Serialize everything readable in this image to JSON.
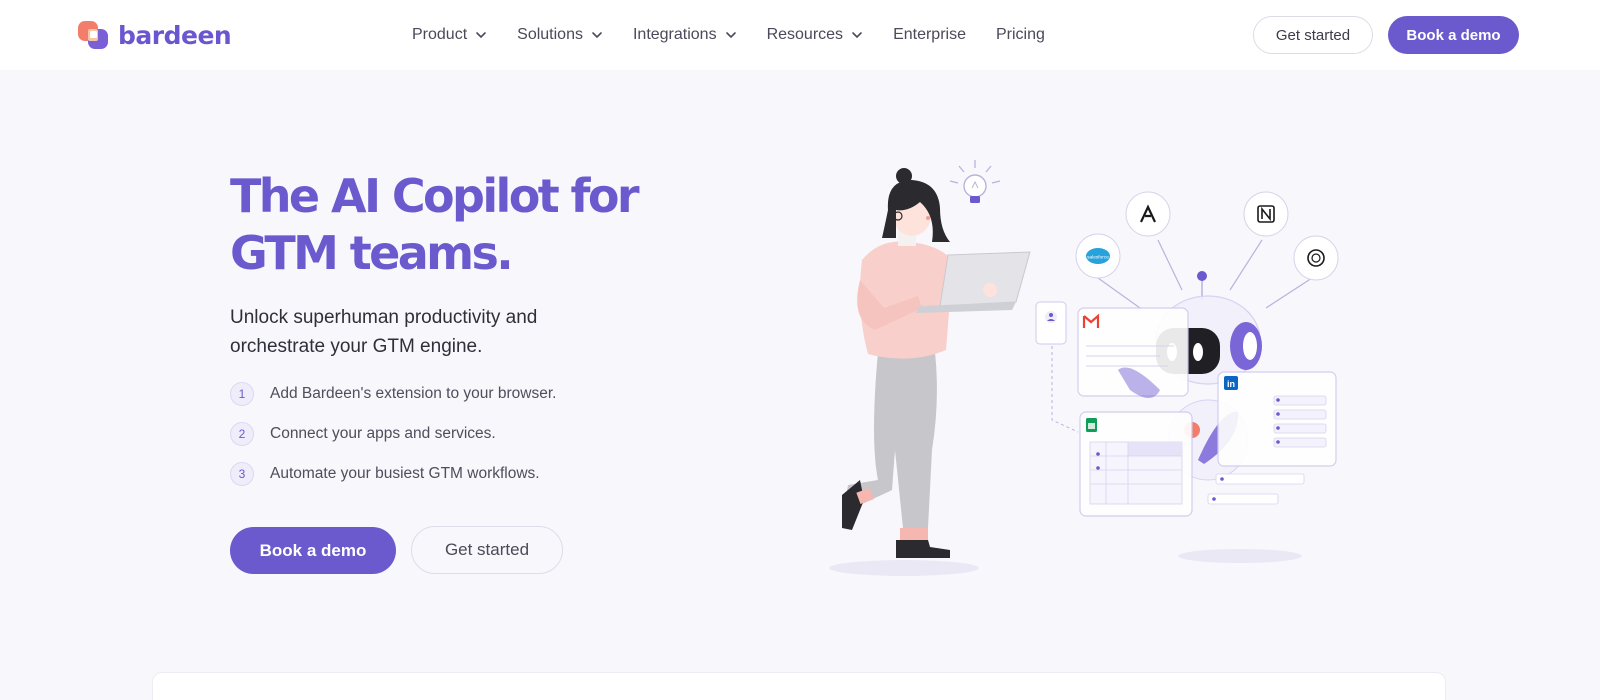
{
  "brand": {
    "name": "bardeen",
    "accent": "#6a5acd"
  },
  "nav": {
    "items": [
      {
        "label": "Product",
        "dropdown": true
      },
      {
        "label": "Solutions",
        "dropdown": true
      },
      {
        "label": "Integrations",
        "dropdown": true
      },
      {
        "label": "Resources",
        "dropdown": true
      },
      {
        "label": "Enterprise",
        "dropdown": false
      },
      {
        "label": "Pricing",
        "dropdown": false
      }
    ],
    "get_started": "Get started",
    "book_demo": "Book a demo"
  },
  "hero": {
    "title_line1": "The AI Copilot for",
    "title_line2": "GTM teams.",
    "subtitle": "Unlock superhuman productivity and orchestrate your GTM engine.",
    "steps": [
      {
        "num": "1",
        "text": "Add Bardeen's extension to your browser."
      },
      {
        "num": "2",
        "text": "Connect your apps and services."
      },
      {
        "num": "3",
        "text": "Automate your busiest GTM workflows."
      }
    ],
    "cta_primary": "Book a demo",
    "cta_secondary": "Get started"
  },
  "illustration": {
    "icons": [
      "lightbulb-icon",
      "salesforce-icon",
      "apollo-icon",
      "notion-icon",
      "openai-icon",
      "gmail-icon",
      "linkedin-icon",
      "google-sheets-icon",
      "contact-card-icon"
    ],
    "salesforce_text": "salesforce"
  }
}
